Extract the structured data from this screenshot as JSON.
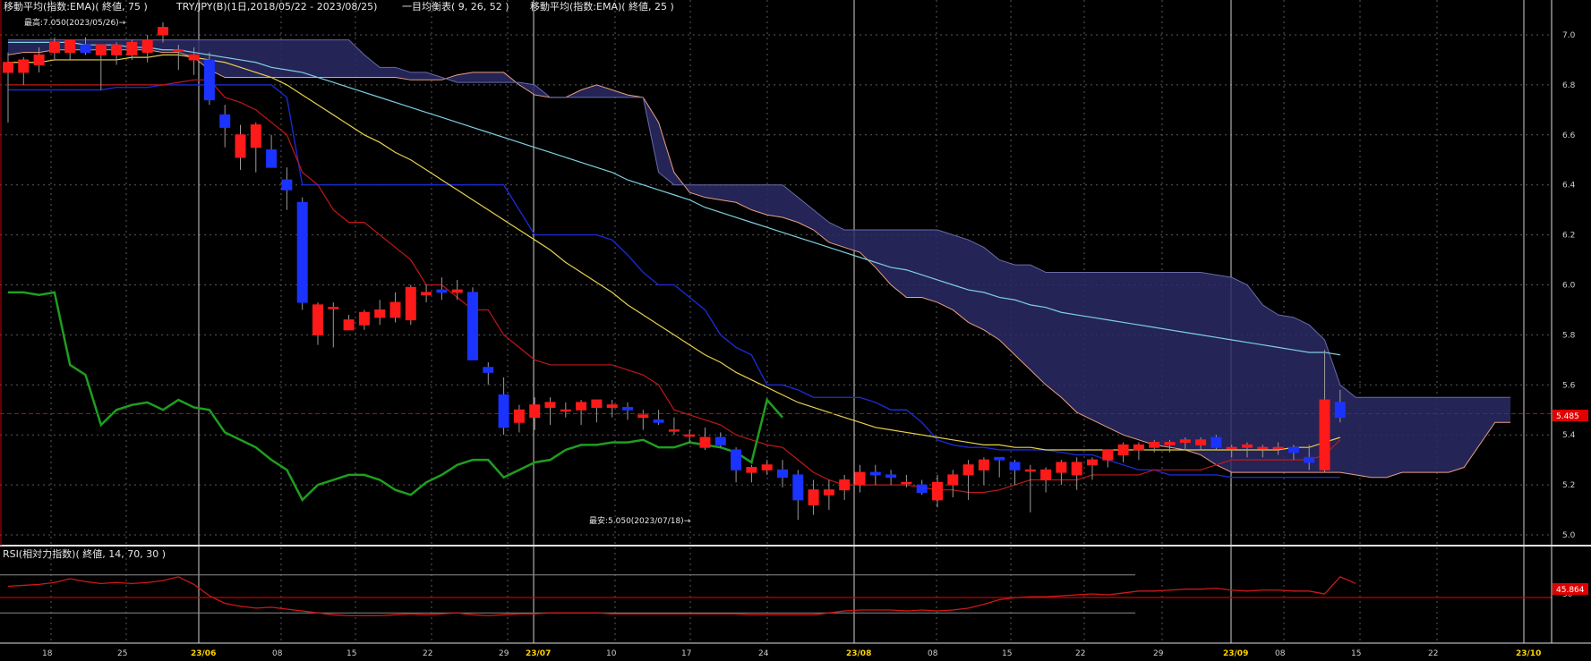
{
  "header": {
    "ema75_label": "移動平均(指数:EMA)( 終値, 75 )",
    "pair_label": "TRY/JPY(B)(1日,2018/05/22 - 2023/08/25)",
    "ichimoku_label": "一目均衡表( 9, 26, 52 )",
    "ema25_label": "移動平均(指数:EMA)( 終値, 25 )"
  },
  "annotations": {
    "high": "最高:7.050(2023/05/26)→",
    "low": "最安:5.050(2023/07/18)→"
  },
  "rsi": {
    "label": "RSI(相対力指数)( 終値, 14, 70, 30 )",
    "value_tag": "45.864"
  },
  "price_tag": "5.485",
  "colors": {
    "bg": "#000000",
    "up": "#ff1a1a",
    "down": "#1a33ff",
    "ema75": "#7fd0e0",
    "ema25": "#e8d050",
    "tenkan": "#c01818",
    "kijun": "#1a2ad0",
    "chikou": "#1f9e1f",
    "cloud": "#2a2a66",
    "cloud_line": "#e8a080",
    "rsi_line": "#d01818",
    "ref_red": "#c80000"
  },
  "chart_data": {
    "type": "candlestick",
    "title": "TRY/JPY(B)(1日,2018/05/22 - 2023/08/25)",
    "ylim": [
      5.0,
      7.0
    ],
    "yticks": [
      "7.0",
      "6.8",
      "6.6",
      "6.4",
      "6.2",
      "6.0",
      "5.8",
      "5.6",
      "5.4",
      "5.2",
      "5.0"
    ],
    "xticks": [
      "18",
      "25",
      "23/06",
      "08",
      "15",
      "22",
      "29",
      "23/07",
      "10",
      "17",
      "24",
      "23/08",
      "08",
      "15",
      "22",
      "29",
      "23/09",
      "08",
      "15",
      "22",
      "23/10"
    ],
    "xticks_highlight": [
      "23/06",
      "23/07",
      "23/08",
      "23/09",
      "23/10"
    ],
    "current_price": 5.485,
    "candles": [
      {
        "o": 6.85,
        "h": 6.93,
        "l": 6.65,
        "c": 6.89
      },
      {
        "o": 6.85,
        "h": 6.91,
        "l": 6.8,
        "c": 6.9
      },
      {
        "o": 6.88,
        "h": 6.95,
        "l": 6.85,
        "c": 6.92
      },
      {
        "o": 6.93,
        "h": 6.99,
        "l": 6.9,
        "c": 6.97
      },
      {
        "o": 6.93,
        "h": 6.98,
        "l": 6.9,
        "c": 6.98
      },
      {
        "o": 6.96,
        "h": 6.99,
        "l": 6.92,
        "c": 6.93
      },
      {
        "o": 6.92,
        "h": 6.96,
        "l": 6.78,
        "c": 6.96
      },
      {
        "o": 6.92,
        "h": 6.97,
        "l": 6.88,
        "c": 6.96
      },
      {
        "o": 6.92,
        "h": 6.98,
        "l": 6.9,
        "c": 6.97
      },
      {
        "o": 6.93,
        "h": 7.0,
        "l": 6.89,
        "c": 6.98
      },
      {
        "o": 7.0,
        "h": 7.05,
        "l": 6.97,
        "c": 7.03
      },
      {
        "o": 6.94,
        "h": 6.96,
        "l": 6.86,
        "c": 6.94
      },
      {
        "o": 6.9,
        "h": 6.95,
        "l": 6.84,
        "c": 6.92
      },
      {
        "o": 6.9,
        "h": 6.93,
        "l": 6.72,
        "c": 6.74
      },
      {
        "o": 6.68,
        "h": 6.72,
        "l": 6.55,
        "c": 6.63
      },
      {
        "o": 6.51,
        "h": 6.64,
        "l": 6.46,
        "c": 6.6
      },
      {
        "o": 6.55,
        "h": 6.65,
        "l": 6.45,
        "c": 6.64
      },
      {
        "o": 6.54,
        "h": 6.6,
        "l": 6.48,
        "c": 6.47
      },
      {
        "o": 6.42,
        "h": 6.47,
        "l": 6.3,
        "c": 6.38
      },
      {
        "o": 6.33,
        "h": 6.35,
        "l": 5.9,
        "c": 5.93
      },
      {
        "o": 5.8,
        "h": 5.93,
        "l": 5.76,
        "c": 5.92
      },
      {
        "o": 5.91,
        "h": 5.93,
        "l": 5.75,
        "c": 5.91
      },
      {
        "o": 5.82,
        "h": 5.88,
        "l": 5.82,
        "c": 5.86
      },
      {
        "o": 5.84,
        "h": 5.9,
        "l": 5.82,
        "c": 5.89
      },
      {
        "o": 5.87,
        "h": 5.94,
        "l": 5.84,
        "c": 5.9
      },
      {
        "o": 5.87,
        "h": 5.97,
        "l": 5.85,
        "c": 5.93
      },
      {
        "o": 5.86,
        "h": 6.0,
        "l": 5.84,
        "c": 5.99
      },
      {
        "o": 5.96,
        "h": 6.0,
        "l": 5.93,
        "c": 5.97
      },
      {
        "o": 5.98,
        "h": 6.03,
        "l": 5.94,
        "c": 5.97
      },
      {
        "o": 5.97,
        "h": 6.02,
        "l": 5.94,
        "c": 5.98
      },
      {
        "o": 5.97,
        "h": 5.99,
        "l": 5.9,
        "c": 5.7
      },
      {
        "o": 5.67,
        "h": 5.69,
        "l": 5.6,
        "c": 5.65
      },
      {
        "o": 5.56,
        "h": 5.63,
        "l": 5.4,
        "c": 5.43
      },
      {
        "o": 5.45,
        "h": 5.52,
        "l": 5.41,
        "c": 5.5
      },
      {
        "o": 5.47,
        "h": 5.55,
        "l": 5.42,
        "c": 5.52
      },
      {
        "o": 5.51,
        "h": 5.55,
        "l": 5.44,
        "c": 5.53
      },
      {
        "o": 5.5,
        "h": 5.53,
        "l": 5.47,
        "c": 5.5
      },
      {
        "o": 5.5,
        "h": 5.54,
        "l": 5.44,
        "c": 5.53
      },
      {
        "o": 5.51,
        "h": 5.53,
        "l": 5.45,
        "c": 5.54
      },
      {
        "o": 5.51,
        "h": 5.54,
        "l": 5.47,
        "c": 5.52
      },
      {
        "o": 5.51,
        "h": 5.53,
        "l": 5.46,
        "c": 5.5
      },
      {
        "o": 5.47,
        "h": 5.5,
        "l": 5.42,
        "c": 5.48
      },
      {
        "o": 5.46,
        "h": 5.5,
        "l": 5.44,
        "c": 5.45
      },
      {
        "o": 5.42,
        "h": 5.47,
        "l": 5.4,
        "c": 5.42
      },
      {
        "o": 5.4,
        "h": 5.42,
        "l": 5.37,
        "c": 5.4
      },
      {
        "o": 5.35,
        "h": 5.43,
        "l": 5.34,
        "c": 5.39
      },
      {
        "o": 5.39,
        "h": 5.41,
        "l": 5.35,
        "c": 5.36
      },
      {
        "o": 5.34,
        "h": 5.35,
        "l": 5.21,
        "c": 5.26
      },
      {
        "o": 5.25,
        "h": 5.28,
        "l": 5.21,
        "c": 5.27
      },
      {
        "o": 5.26,
        "h": 5.3,
        "l": 5.24,
        "c": 5.28
      },
      {
        "o": 5.26,
        "h": 5.3,
        "l": 5.19,
        "c": 5.23
      },
      {
        "o": 5.24,
        "h": 5.26,
        "l": 5.06,
        "c": 5.14
      },
      {
        "o": 5.12,
        "h": 5.22,
        "l": 5.08,
        "c": 5.18
      },
      {
        "o": 5.16,
        "h": 5.22,
        "l": 5.1,
        "c": 5.18
      },
      {
        "o": 5.18,
        "h": 5.24,
        "l": 5.14,
        "c": 5.22
      },
      {
        "o": 5.2,
        "h": 5.28,
        "l": 5.17,
        "c": 5.25
      },
      {
        "o": 5.25,
        "h": 5.28,
        "l": 5.2,
        "c": 5.24
      },
      {
        "o": 5.24,
        "h": 5.26,
        "l": 5.2,
        "c": 5.23
      },
      {
        "o": 5.21,
        "h": 5.24,
        "l": 5.19,
        "c": 5.21
      },
      {
        "o": 5.2,
        "h": 5.22,
        "l": 5.16,
        "c": 5.17
      },
      {
        "o": 5.14,
        "h": 5.24,
        "l": 5.11,
        "c": 5.21
      },
      {
        "o": 5.2,
        "h": 5.26,
        "l": 5.15,
        "c": 5.24
      },
      {
        "o": 5.24,
        "h": 5.3,
        "l": 5.14,
        "c": 5.28
      },
      {
        "o": 5.26,
        "h": 5.31,
        "l": 5.2,
        "c": 5.3
      },
      {
        "o": 5.31,
        "h": 5.31,
        "l": 5.23,
        "c": 5.3
      },
      {
        "o": 5.29,
        "h": 5.3,
        "l": 5.2,
        "c": 5.26
      },
      {
        "o": 5.26,
        "h": 5.28,
        "l": 5.09,
        "c": 5.26
      },
      {
        "o": 5.22,
        "h": 5.27,
        "l": 5.17,
        "c": 5.26
      },
      {
        "o": 5.25,
        "h": 5.3,
        "l": 5.2,
        "c": 5.29
      },
      {
        "o": 5.24,
        "h": 5.31,
        "l": 5.18,
        "c": 5.29
      },
      {
        "o": 5.28,
        "h": 5.31,
        "l": 5.22,
        "c": 5.3
      },
      {
        "o": 5.3,
        "h": 5.34,
        "l": 5.27,
        "c": 5.34
      },
      {
        "o": 5.32,
        "h": 5.37,
        "l": 5.29,
        "c": 5.36
      },
      {
        "o": 5.34,
        "h": 5.37,
        "l": 5.3,
        "c": 5.36
      },
      {
        "o": 5.35,
        "h": 5.38,
        "l": 5.33,
        "c": 5.37
      },
      {
        "o": 5.36,
        "h": 5.38,
        "l": 5.33,
        "c": 5.37
      },
      {
        "o": 5.37,
        "h": 5.39,
        "l": 5.34,
        "c": 5.38
      },
      {
        "o": 5.36,
        "h": 5.39,
        "l": 5.34,
        "c": 5.38
      },
      {
        "o": 5.39,
        "h": 5.4,
        "l": 5.34,
        "c": 5.35
      },
      {
        "o": 5.35,
        "h": 5.36,
        "l": 5.31,
        "c": 5.35
      },
      {
        "o": 5.35,
        "h": 5.37,
        "l": 5.31,
        "c": 5.36
      },
      {
        "o": 5.35,
        "h": 5.36,
        "l": 5.31,
        "c": 5.35
      },
      {
        "o": 5.35,
        "h": 5.37,
        "l": 5.32,
        "c": 5.35
      },
      {
        "o": 5.35,
        "h": 5.36,
        "l": 5.3,
        "c": 5.33
      },
      {
        "o": 5.31,
        "h": 5.36,
        "l": 5.26,
        "c": 5.29
      },
      {
        "o": 5.26,
        "h": 5.74,
        "l": 5.25,
        "c": 5.54
      },
      {
        "o": 5.53,
        "h": 5.58,
        "l": 5.45,
        "c": 5.47
      }
    ],
    "ema25": [
      6.89,
      6.89,
      6.89,
      6.9,
      6.9,
      6.9,
      6.9,
      6.9,
      6.91,
      6.91,
      6.92,
      6.92,
      6.91,
      6.9,
      6.89,
      6.87,
      6.85,
      6.83,
      6.8,
      6.76,
      6.72,
      6.68,
      6.64,
      6.6,
      6.57,
      6.53,
      6.5,
      6.46,
      6.42,
      6.38,
      6.34,
      6.3,
      6.26,
      6.22,
      6.18,
      6.14,
      6.09,
      6.05,
      6.01,
      5.97,
      5.92,
      5.88,
      5.84,
      5.8,
      5.76,
      5.72,
      5.69,
      5.65,
      5.62,
      5.59,
      5.56,
      5.53,
      5.51,
      5.49,
      5.47,
      5.45,
      5.43,
      5.42,
      5.41,
      5.4,
      5.39,
      5.38,
      5.37,
      5.36,
      5.36,
      5.35,
      5.35,
      5.34,
      5.34,
      5.34,
      5.34,
      5.34,
      5.34,
      5.34,
      5.34,
      5.34,
      5.34,
      5.34,
      5.34,
      5.34,
      5.34,
      5.34,
      5.34,
      5.35,
      5.35,
      5.37,
      5.39
    ],
    "ema75": [
      6.97,
      6.97,
      6.97,
      6.97,
      6.97,
      6.96,
      6.96,
      6.96,
      6.95,
      6.95,
      6.94,
      6.94,
      6.93,
      6.92,
      6.91,
      6.9,
      6.89,
      6.87,
      6.86,
      6.85,
      6.83,
      6.81,
      6.79,
      6.77,
      6.75,
      6.73,
      6.71,
      6.69,
      6.67,
      6.65,
      6.63,
      6.61,
      6.59,
      6.57,
      6.55,
      6.53,
      6.51,
      6.49,
      6.47,
      6.45,
      6.42,
      6.4,
      6.38,
      6.36,
      6.34,
      6.31,
      6.29,
      6.27,
      6.25,
      6.23,
      6.21,
      6.19,
      6.17,
      6.15,
      6.13,
      6.11,
      6.09,
      6.07,
      6.06,
      6.04,
      6.02,
      6.0,
      5.98,
      5.97,
      5.95,
      5.94,
      5.92,
      5.91,
      5.89,
      5.88,
      5.87,
      5.86,
      5.85,
      5.84,
      5.83,
      5.82,
      5.81,
      5.8,
      5.79,
      5.78,
      5.77,
      5.76,
      5.75,
      5.74,
      5.73,
      5.73,
      5.72
    ],
    "tenkan": [
      6.8,
      6.8,
      6.8,
      6.8,
      6.8,
      6.8,
      6.8,
      6.8,
      6.8,
      6.8,
      6.8,
      6.81,
      6.82,
      6.82,
      6.75,
      6.73,
      6.7,
      6.65,
      6.6,
      6.45,
      6.4,
      6.3,
      6.25,
      6.25,
      6.2,
      6.15,
      6.1,
      6.0,
      6.0,
      5.95,
      5.9,
      5.9,
      5.8,
      5.75,
      5.7,
      5.68,
      5.68,
      5.68,
      5.68,
      5.68,
      5.66,
      5.64,
      5.6,
      5.5,
      5.48,
      5.46,
      5.44,
      5.4,
      5.38,
      5.36,
      5.35,
      5.3,
      5.25,
      5.22,
      5.2,
      5.2,
      5.2,
      5.2,
      5.2,
      5.19,
      5.18,
      5.18,
      5.17,
      5.17,
      5.18,
      5.2,
      5.22,
      5.22,
      5.22,
      5.22,
      5.24,
      5.24,
      5.24,
      5.24,
      5.26,
      5.26,
      5.26,
      5.26,
      5.28,
      5.3,
      5.3,
      5.3,
      5.3,
      5.3,
      5.3,
      5.32,
      5.38
    ],
    "kijun": [
      6.78,
      6.78,
      6.78,
      6.78,
      6.78,
      6.78,
      6.78,
      6.79,
      6.79,
      6.79,
      6.8,
      6.8,
      6.8,
      6.8,
      6.8,
      6.8,
      6.8,
      6.8,
      6.75,
      6.4,
      6.4,
      6.4,
      6.4,
      6.4,
      6.4,
      6.4,
      6.4,
      6.4,
      6.4,
      6.4,
      6.4,
      6.4,
      6.4,
      6.3,
      6.2,
      6.2,
      6.2,
      6.2,
      6.2,
      6.18,
      6.12,
      6.05,
      6.0,
      6.0,
      5.95,
      5.9,
      5.8,
      5.75,
      5.72,
      5.6,
      5.6,
      5.58,
      5.55,
      5.55,
      5.55,
      5.55,
      5.53,
      5.5,
      5.5,
      5.45,
      5.38,
      5.36,
      5.35,
      5.35,
      5.34,
      5.34,
      5.34,
      5.34,
      5.33,
      5.32,
      5.32,
      5.3,
      5.28,
      5.26,
      5.26,
      5.24,
      5.24,
      5.24,
      5.24,
      5.23,
      5.23,
      5.23,
      5.23,
      5.23,
      5.23,
      5.23,
      5.23
    ],
    "chikou": [
      5.97,
      5.97,
      5.96,
      5.97,
      5.68,
      5.64,
      5.44,
      5.5,
      5.52,
      5.53,
      5.5,
      5.54,
      5.51,
      5.5,
      5.41,
      5.38,
      5.35,
      5.3,
      5.26,
      5.14,
      5.2,
      5.22,
      5.24,
      5.24,
      5.22,
      5.18,
      5.16,
      5.21,
      5.24,
      5.28,
      5.3,
      5.3,
      5.23,
      5.26,
      5.29,
      5.3,
      5.34,
      5.36,
      5.36,
      5.37,
      5.37,
      5.38,
      5.35,
      5.35,
      5.37,
      5.36,
      5.35,
      5.33,
      5.29,
      5.54,
      5.47
    ],
    "cloud": {
      "x_start": 0,
      "span_a": [
        6.92,
        6.93,
        6.93,
        6.94,
        6.94,
        6.94,
        6.94,
        6.94,
        6.94,
        6.94,
        6.93,
        6.93,
        6.91,
        6.86,
        6.83,
        6.83,
        6.83,
        6.83,
        6.83,
        6.83,
        6.83,
        6.83,
        6.83,
        6.83,
        6.83,
        6.83,
        6.82,
        6.82,
        6.82,
        6.84,
        6.85,
        6.85,
        6.85,
        6.8,
        6.76,
        6.75,
        6.75,
        6.78,
        6.8,
        6.78,
        6.76,
        6.75,
        6.65,
        6.45,
        6.37,
        6.35,
        6.34,
        6.33,
        6.3,
        6.28,
        6.27,
        6.25,
        6.22,
        6.17,
        6.15,
        6.13,
        6.07,
        6.0,
        5.95,
        5.95,
        5.93,
        5.9,
        5.85,
        5.82,
        5.78,
        5.72,
        5.66,
        5.6,
        5.55,
        5.49,
        5.46,
        5.43,
        5.4,
        5.38,
        5.36,
        5.35,
        5.34,
        5.32,
        5.28,
        5.25,
        5.25,
        5.25,
        5.25,
        5.25,
        5.25,
        5.25,
        5.25,
        5.24,
        5.23,
        5.23,
        5.25,
        5.25,
        5.25,
        5.25,
        5.27,
        5.36,
        5.45,
        5.45
      ],
      "span_b": [
        6.98,
        6.98,
        6.98,
        6.98,
        6.98,
        6.98,
        6.98,
        6.98,
        6.98,
        6.98,
        6.98,
        6.98,
        6.98,
        6.98,
        6.98,
        6.98,
        6.98,
        6.98,
        6.98,
        6.98,
        6.98,
        6.98,
        6.98,
        6.92,
        6.87,
        6.87,
        6.85,
        6.85,
        6.83,
        6.81,
        6.81,
        6.81,
        6.81,
        6.81,
        6.8,
        6.75,
        6.75,
        6.75,
        6.75,
        6.75,
        6.75,
        6.75,
        6.45,
        6.4,
        6.4,
        6.4,
        6.4,
        6.4,
        6.4,
        6.4,
        6.4,
        6.35,
        6.3,
        6.25,
        6.22,
        6.22,
        6.22,
        6.22,
        6.22,
        6.22,
        6.22,
        6.2,
        6.18,
        6.15,
        6.1,
        6.08,
        6.08,
        6.05,
        6.05,
        6.05,
        6.05,
        6.05,
        6.05,
        6.05,
        6.05,
        6.05,
        6.05,
        6.05,
        6.04,
        6.03,
        6.0,
        5.92,
        5.88,
        5.87,
        5.84,
        5.78,
        5.6,
        5.55,
        5.55,
        5.55,
        5.55,
        5.55,
        5.55,
        5.55,
        5.55,
        5.55,
        5.55,
        5.55
      ]
    },
    "rsi": {
      "range": [
        0,
        100
      ],
      "levels": [
        70,
        50,
        30
      ],
      "current": 45.864,
      "values": [
        58,
        59,
        60,
        62,
        66,
        63,
        61,
        62,
        61,
        62,
        64,
        68,
        60,
        48,
        40,
        37,
        35,
        36,
        34,
        32,
        30,
        28,
        27,
        27,
        27,
        28,
        29,
        28,
        29,
        30,
        28,
        27,
        28,
        29,
        29,
        30,
        30,
        30,
        30,
        29,
        29,
        29,
        29,
        29,
        29,
        29,
        29,
        29,
        28,
        28,
        28,
        28,
        28,
        30,
        32,
        33,
        33,
        33,
        32,
        33,
        32,
        33,
        35,
        39,
        44,
        46,
        47,
        47,
        48,
        49,
        50,
        49,
        51,
        53,
        53,
        54,
        55,
        55,
        56,
        54,
        53,
        54,
        54,
        53,
        53,
        50,
        68,
        61
      ]
    }
  }
}
